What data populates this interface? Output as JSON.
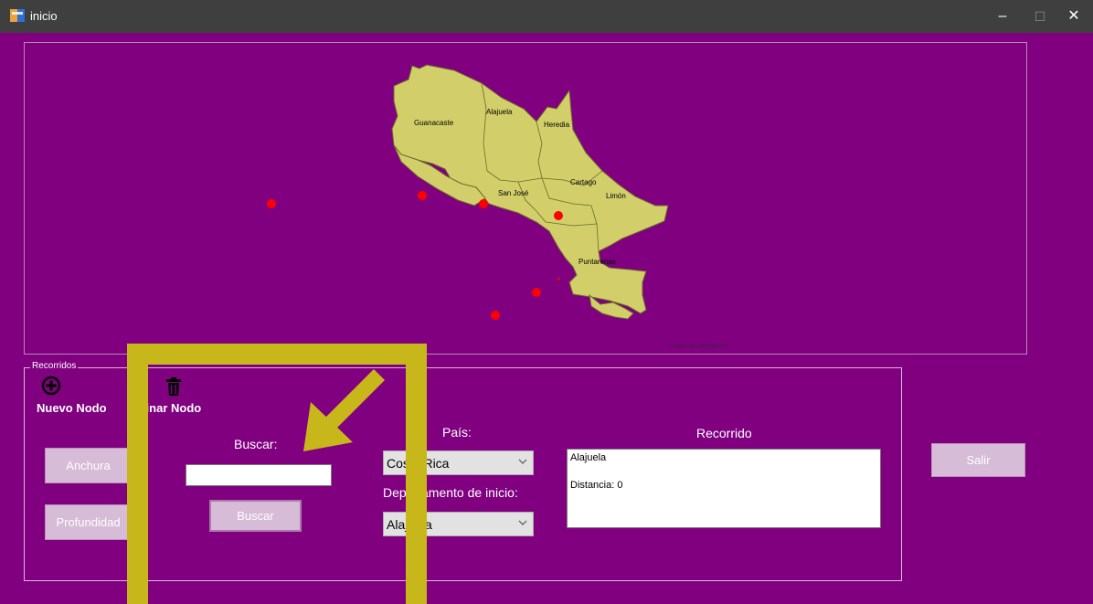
{
  "window": {
    "title": "inicio",
    "controls": {
      "minimize": "–",
      "maximize": "☐",
      "close": "✕"
    }
  },
  "map": {
    "regions": [
      "Guanacaste",
      "Alajuela",
      "Heredia",
      "San José",
      "Cartago",
      "Limón",
      "Puntarenas"
    ],
    "credit": "Created with paintmaps.com",
    "colors": {
      "land": "#d2cf6a",
      "border": "#6b6a2a",
      "node": "#ff0000",
      "background": "#800080"
    }
  },
  "recorridos": {
    "group_label": "Recorridos",
    "new_node_label": "Nuevo Nodo",
    "delete_node_label": "minar Nodo",
    "anchura_label": "Anchura",
    "profundidad_label": "Profundidad",
    "buscar_label": "Buscar:",
    "buscar_input_value": "",
    "buscar_button": "Buscar",
    "pais_label": "País:",
    "pais_value": "Costa Rica",
    "departamento_label": "Departamento de inicio:",
    "departamento_value": "Alajuela",
    "recorrido_label": "Recorrido",
    "recorrido_lines": [
      "Alajuela",
      "Distancia: 0"
    ],
    "salir_label": "Salir"
  },
  "annotation": {
    "color": "#c8b71a"
  }
}
